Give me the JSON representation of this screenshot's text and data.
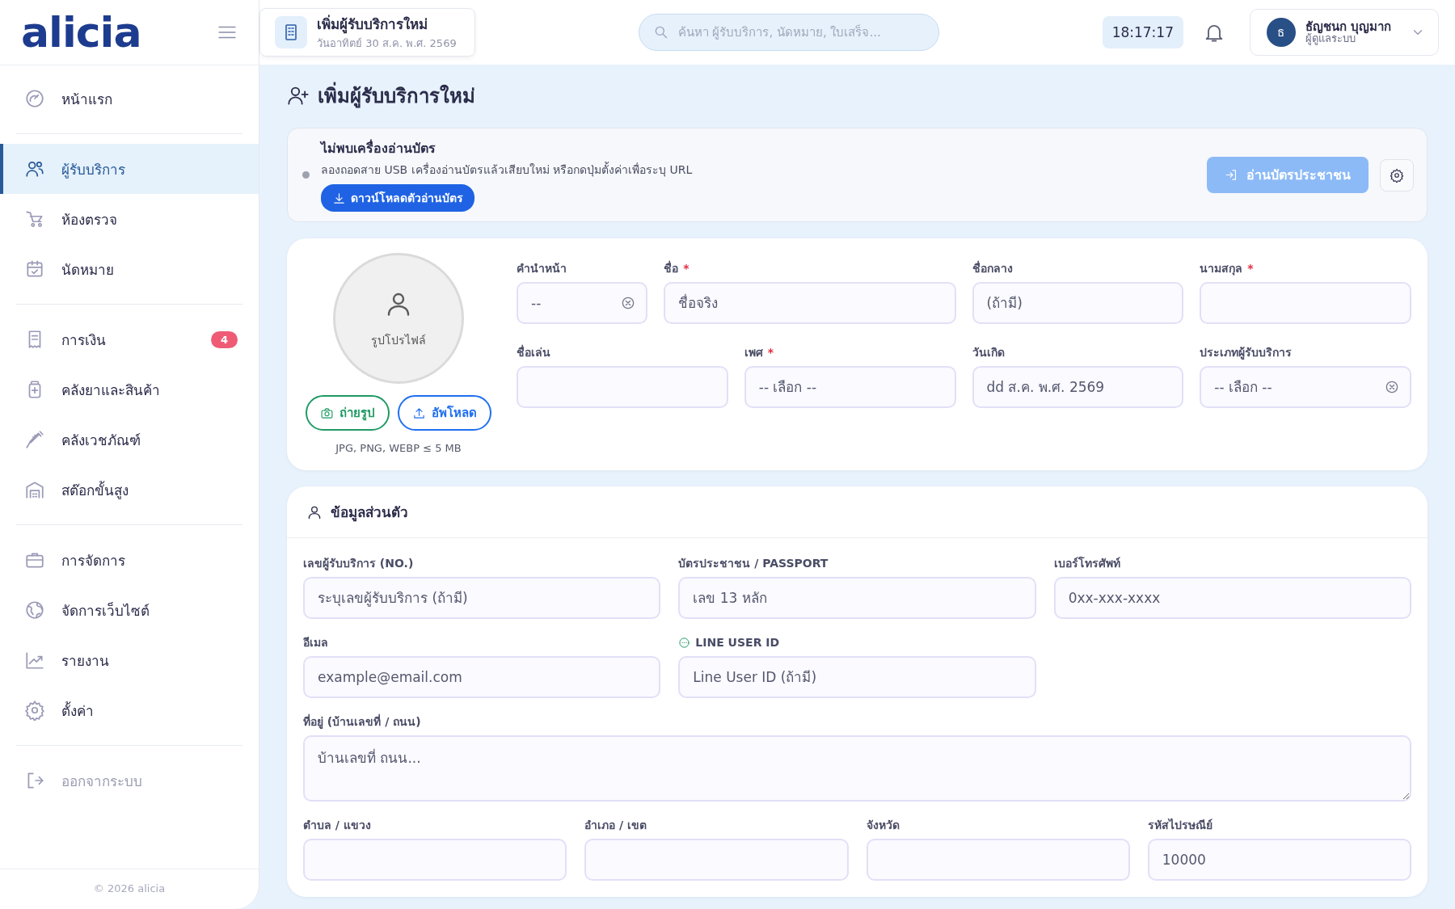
{
  "sidebar": {
    "logo": "alicia",
    "groups": [
      [
        {
          "label": "หน้าแรก",
          "selected": false
        }
      ],
      [
        {
          "label": "ผู้รับบริการ",
          "selected": true
        },
        {
          "label": "ห้องตรวจ",
          "selected": false
        },
        {
          "label": "นัดหมาย",
          "selected": false
        }
      ],
      [
        {
          "label": "การเงิน",
          "selected": false,
          "badge": "4"
        },
        {
          "label": "คลังยาและสินค้า",
          "selected": false
        },
        {
          "label": "คลังเวชภัณฑ์",
          "selected": false
        },
        {
          "label": "สต๊อกขั้นสูง",
          "selected": false
        }
      ],
      [
        {
          "label": "การจัดการ",
          "selected": false
        },
        {
          "label": "จัดการเว็บไซต์",
          "selected": false
        },
        {
          "label": "รายงาน",
          "selected": false
        },
        {
          "label": "ตั้งค่า",
          "selected": false
        }
      ]
    ],
    "logout": "ออกจากระบบ",
    "footer": "© 2026 alicia"
  },
  "header": {
    "page_tab": {
      "title": "เพิ่มผู้รับบริการใหม่",
      "subtitle": "วันอาทิตย์ 30 ส.ค. พ.ศ. 2569"
    },
    "search": {
      "placeholder": "ค้นหา ผู้รับบริการ, นัดหมาย, ใบเสร็จ..."
    },
    "time": "18:17:17",
    "user": {
      "initial": "ธ",
      "name": "ธัญชนก บุญมาก",
      "role": "ผู้ดูแลระบบ"
    }
  },
  "page_title": "เพิ่มผู้รับบริการใหม่",
  "card_reader": {
    "title": "ไม่พบเครื่องอ่านบัตร",
    "message": "ลองถอดสาย USB เครื่องอ่านบัตรแล้วเสียบใหม่ หรือกดปุ่มตั้งค่าเพื่อระบุ URL",
    "download_button": "ดาวน์โหลดตัวอ่านบัตร",
    "read_button": {
      "label": "อ่านบัตรประชาชน",
      "disabled": true
    }
  },
  "profile": {
    "photo_label": "รูปโปรไฟล์",
    "buttons": [
      {
        "label": "ถ่ายรูป",
        "kind": "camera"
      },
      {
        "label": "อัพโหลด",
        "kind": "upload"
      }
    ],
    "hint": "JPG, PNG, WEBP ≤ 5 MB",
    "rows": [
      [
        {
          "label": "คำนำหน้า",
          "placeholder": "--",
          "kind": "clearable"
        },
        {
          "label": "ชื่อ",
          "required_mark": "*",
          "placeholder": "ชื่อจริง",
          "kind": "text"
        },
        {
          "label": "ชื่อกลาง",
          "placeholder": "(ถ้ามี)",
          "kind": "text"
        },
        {
          "label": "นามสกุล",
          "required_mark": "*",
          "kind": "text"
        }
      ],
      [
        {
          "label": "ชื่อเล่น",
          "kind": "text"
        },
        {
          "label": "เพศ",
          "required_mark": "*",
          "placeholder": "-- เลือก --",
          "kind": "select"
        },
        {
          "label": "วันเกิด",
          "placeholder": "dd ส.ค. พ.ศ. 2569",
          "kind": "text"
        },
        {
          "label": "ประเภทผู้รับบริการ",
          "placeholder": "-- เลือก --",
          "kind": "clearable"
        }
      ]
    ]
  },
  "personal": {
    "title": "ข้อมูลส่วนตัว",
    "rows": [
      [
        {
          "label": "เลขผู้รับบริการ (NO.)",
          "placeholder": "ระบุเลขผู้รับบริการ (ถ้ามี)",
          "kind": "text"
        },
        {
          "label": "บัตรประชาชน / PASSPORT",
          "placeholder": "เลข 13 หลัก",
          "kind": "text"
        },
        {
          "label": "เบอร์โทรศัพท์",
          "placeholder": "0xx-xxx-xxxx",
          "kind": "text"
        }
      ],
      [
        {
          "label": "อีเมล",
          "placeholder": "example@email.com",
          "kind": "text"
        },
        {
          "label": "LINE USER ID",
          "placeholder": "Line User ID (ถ้ามี)",
          "kind": "line"
        }
      ],
      [
        {
          "label": "ที่อยู่ (บ้านเลขที่ / ถนน)",
          "placeholder": "บ้านเลขที่ ถนน...",
          "kind": "textarea"
        }
      ],
      [
        {
          "label": "ตำบล / แขวง",
          "kind": "text"
        },
        {
          "label": "อำเภอ / เขต",
          "kind": "text"
        },
        {
          "label": "จังหวัด",
          "kind": "text"
        },
        {
          "label": "รหัสไปรษณีย์",
          "placeholder": "10000",
          "kind": "text"
        }
      ]
    ]
  }
}
